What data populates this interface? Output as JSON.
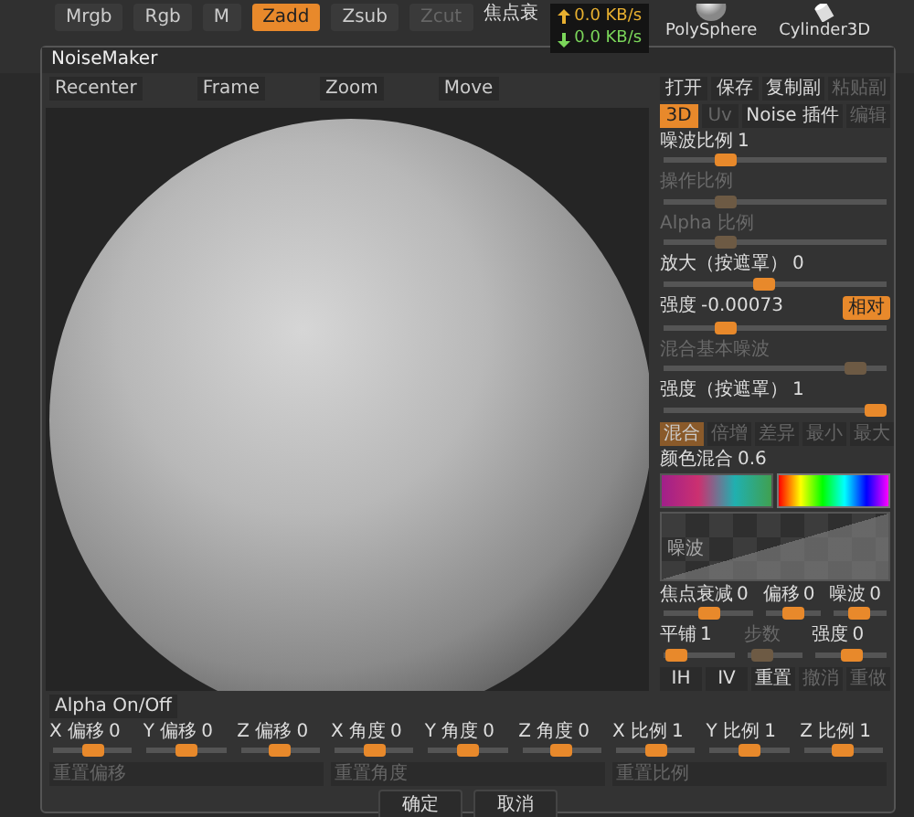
{
  "app_toolbar": {
    "items": [
      {
        "label": "Mrgb",
        "selected": false,
        "disabled": false
      },
      {
        "label": "Rgb",
        "selected": false,
        "disabled": false
      },
      {
        "label": "M",
        "selected": false,
        "disabled": false
      },
      {
        "label": "Zadd",
        "selected": true,
        "disabled": false
      },
      {
        "label": "Zsub",
        "selected": false,
        "disabled": false
      },
      {
        "label": "Zcut",
        "selected": false,
        "disabled": true
      }
    ],
    "focal_label": "焦点衰",
    "network": {
      "upload": "0.0 KB/s",
      "download": "0.0 KB/s"
    },
    "tool_thumbs": [
      {
        "label": "PolySphere",
        "kind": "sphere"
      },
      {
        "label": "Cylinder3D",
        "kind": "cylinder"
      }
    ]
  },
  "dialog": {
    "title": "NoiseMaker",
    "toolbar": [
      {
        "label": "Recenter"
      },
      {
        "label": "Frame"
      },
      {
        "label": "Zoom"
      },
      {
        "label": "Move"
      }
    ],
    "alpha_toggle": "Alpha On/Off",
    "file_buttons": [
      {
        "label": "打开",
        "disabled": false
      },
      {
        "label": "保存",
        "disabled": false
      },
      {
        "label": "复制副",
        "disabled": false
      },
      {
        "label": "粘贴副",
        "disabled": true
      }
    ],
    "tabs": [
      {
        "label": "3D",
        "selected": true,
        "disabled": false
      },
      {
        "label": "Uv",
        "selected": false,
        "disabled": true
      },
      {
        "label": "Noise 插件",
        "selected": false,
        "disabled": false
      },
      {
        "label": "编辑",
        "selected": false,
        "disabled": true
      }
    ],
    "sliders": [
      {
        "label": "噪波比例",
        "value": "1",
        "level": 0.25,
        "disabled": false
      },
      {
        "label": "操作比例",
        "level": 0.25,
        "disabled": true
      },
      {
        "label": "Alpha 比例",
        "level": 0.25,
        "disabled": true
      },
      {
        "label": "放大（按遮罩）",
        "value": "0",
        "level": 0.45,
        "disabled": false
      },
      {
        "label": "强度",
        "value": "-0.00073",
        "level": 0.25,
        "disabled": false,
        "button": {
          "label": "相对",
          "on": true
        }
      },
      {
        "label": "混合基本噪波",
        "level": 0.9,
        "disabled": true
      },
      {
        "label": "强度（按遮罩）",
        "value": "1",
        "level": 1,
        "disabled": false
      }
    ],
    "blend_modes": [
      {
        "label": "混合",
        "selected": true
      },
      {
        "label": "倍增",
        "selected": false
      },
      {
        "label": "差异",
        "selected": false
      },
      {
        "label": "最小",
        "selected": false
      },
      {
        "label": "最大",
        "selected": false
      }
    ],
    "color_mix": {
      "label": "颜色混合",
      "value": "0.6"
    },
    "preview_label": "噪波",
    "lower_sliders": [
      [
        {
          "label": "焦点衰减",
          "value": "0",
          "level": 0.5,
          "disabled": false
        },
        {
          "label": "偏移",
          "value": "0",
          "level": 0.5,
          "disabled": false
        },
        {
          "label": "噪波",
          "value": "0",
          "level": 0.5,
          "disabled": false
        }
      ],
      [
        {
          "label": "平铺",
          "value": "1",
          "level": 0.05,
          "disabled": false
        },
        {
          "label": "步数",
          "level": 0.1,
          "disabled": true
        },
        {
          "label": "强度",
          "value": "0",
          "level": 0.5,
          "disabled": false
        }
      ]
    ],
    "tile_buttons": [
      {
        "label": "IH",
        "disabled": false
      },
      {
        "label": "IV",
        "disabled": false
      },
      {
        "label": "重置",
        "disabled": false
      },
      {
        "label": "撤消",
        "disabled": true
      },
      {
        "label": "重做",
        "disabled": true
      }
    ],
    "transform_sliders": [
      {
        "label": "X 偏移",
        "value": "0",
        "level": 0.5
      },
      {
        "label": "Y 偏移",
        "value": "0",
        "level": 0.5
      },
      {
        "label": "Z 偏移",
        "value": "0",
        "level": 0.5
      },
      {
        "label": "X 角度",
        "value": "0",
        "level": 0.5
      },
      {
        "label": "Y 角度",
        "value": "0",
        "level": 0.5
      },
      {
        "label": "Z 角度",
        "value": "0",
        "level": 0.5
      },
      {
        "label": "X 比例",
        "value": "1",
        "level": 0.5
      },
      {
        "label": "Y 比例",
        "value": "1",
        "level": 0.5
      },
      {
        "label": "Z 比例",
        "value": "1",
        "level": 0.5
      }
    ],
    "reset_buttons": [
      {
        "label": "重置偏移",
        "disabled": true
      },
      {
        "label": "重置角度",
        "disabled": true
      },
      {
        "label": "重置比例",
        "disabled": true
      }
    ],
    "actions": [
      {
        "label": "确定"
      },
      {
        "label": "取消"
      }
    ]
  }
}
